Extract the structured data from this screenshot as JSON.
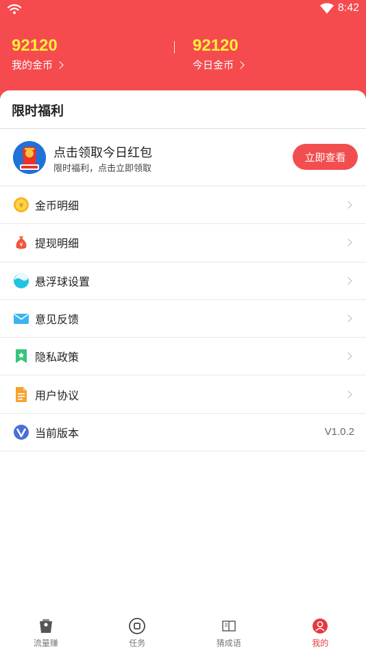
{
  "status_bar": {
    "time": "8:42",
    "left_icon": "wifi-icon",
    "right_icon": "wifi-signal-icon"
  },
  "header": {
    "my_coins": {
      "value": "92120",
      "label": "我的金币"
    },
    "today_coins": {
      "value": "92120",
      "label": "今日金币"
    }
  },
  "section": {
    "title": "限时福利"
  },
  "promo": {
    "title": "点击领取今日红包",
    "subtitle": "限时福利，点击立即领取",
    "button": "立即查看",
    "icon": "red-envelope-icon"
  },
  "menu": [
    {
      "label": "金币明细",
      "icon": "coin-icon"
    },
    {
      "label": "提现明细",
      "icon": "money-bag-icon"
    },
    {
      "label": "悬浮球设置",
      "icon": "float-ball-icon"
    },
    {
      "label": "意见反馈",
      "icon": "mail-icon"
    },
    {
      "label": "隐私政策",
      "icon": "bookmark-star-icon"
    },
    {
      "label": "用户协议",
      "icon": "document-icon"
    },
    {
      "label": "当前版本",
      "icon": "version-v-icon",
      "value": "V1.0.2"
    }
  ],
  "tabs": [
    {
      "label": "流量赚",
      "icon": "phone-icon",
      "active": false
    },
    {
      "label": "任务",
      "icon": "task-circle-icon",
      "active": false
    },
    {
      "label": "猜成语",
      "icon": "book-icon",
      "active": false
    },
    {
      "label": "我的",
      "icon": "user-icon",
      "active": true
    }
  ],
  "colors": {
    "brand_red": "#f54b4f",
    "coin_yellow": "#ffee3b",
    "active_tab": "#e8383d"
  }
}
